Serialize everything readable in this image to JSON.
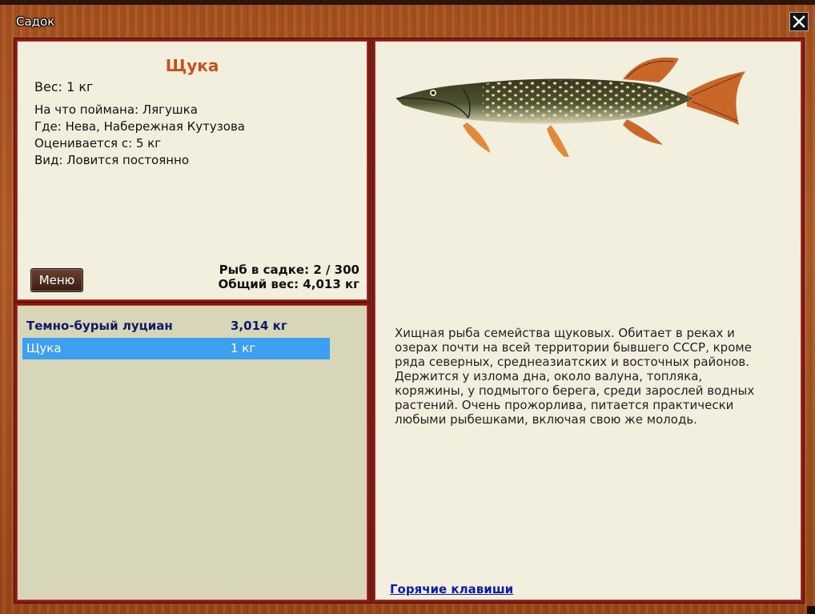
{
  "window": {
    "title": "Садок"
  },
  "info": {
    "name": "Щука",
    "weight": "Вес: 1 кг",
    "details": [
      "На что поймана: Лягушка",
      "Где: Нева, Набережная Кутузова",
      "Оценивается с: 5 кг",
      "Вид: Ловится постоянно"
    ],
    "menu_label": "Меню",
    "stats": {
      "fish_count": "Рыб в садке: 2 / 300",
      "total_weight": "Общий вес: 4,013 кг"
    }
  },
  "catch_list": [
    {
      "name": "Темно-бурый луциан",
      "weight": "3,014 кг",
      "selected": false
    },
    {
      "name": "Щука",
      "weight": "1 кг",
      "selected": true
    }
  ],
  "description": {
    "text": "Хищная рыба семейства щуковых. Обитает в реках и озерах почти на всей территории бывшего СССР, кроме ряда северных, среднеазиатских и восточных районов.  Держится у излома дна, около валуна, топляка, коряжины, у подмытого берега, среди зарослей водных растений. Очень прожорлива, питается практически любыми рыбешками, включая свою же молодь.",
    "hotkeys_label": "Горячие клавиши"
  },
  "colors": {
    "frame": "#8a1a14",
    "panel_bg": "#f3efdf",
    "list_bg": "#d8d6b8",
    "selected_row": "#3d9ff0",
    "fish_name": "#c8501b",
    "link": "#0b1ba8"
  },
  "icons": {
    "close": "close-icon",
    "fish": "pike-fish-image"
  }
}
